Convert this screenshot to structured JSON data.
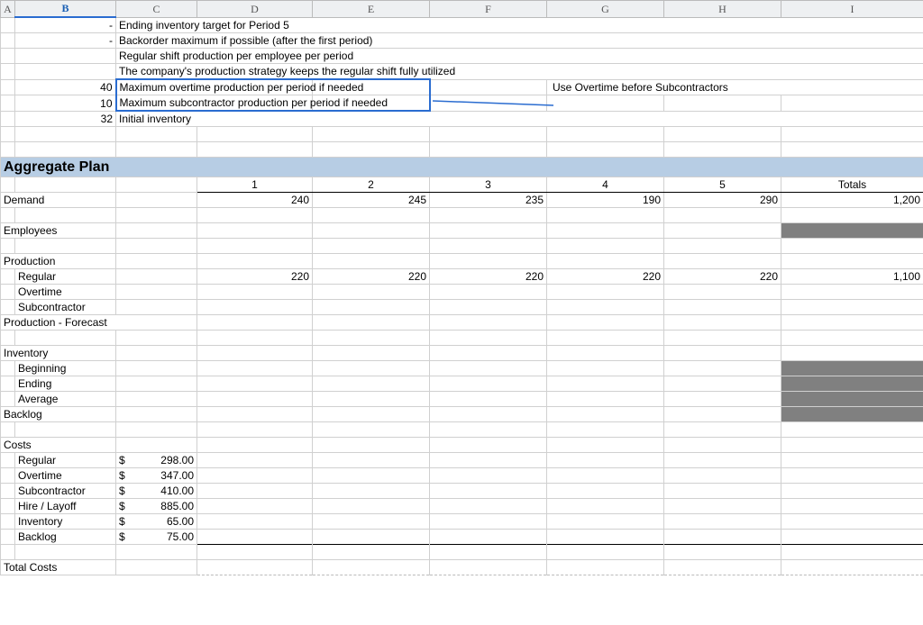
{
  "columns": [
    "A",
    "B",
    "C",
    "D",
    "E",
    "F",
    "G",
    "H",
    "I"
  ],
  "selectedColumn": "B",
  "assumptions": {
    "r1": {
      "b": "-",
      "c": "Ending inventory target for Period 5"
    },
    "r2": {
      "b": "-",
      "c": "Backorder maximum if possible (after the first period)"
    },
    "r3": {
      "c": "Regular shift production per employee per period"
    },
    "r4": {
      "c": "The company's production strategy keeps the regular shift fully utilized"
    },
    "r5": {
      "b": "40",
      "c": "Maximum overtime production per period if needed"
    },
    "r6": {
      "b": "10",
      "c": "Maximum subcontractor production per period if needed"
    },
    "r7": {
      "b": "32",
      "c": "Initial inventory"
    }
  },
  "callout": "Use Overtime before Subcontractors",
  "section_title": "Aggregate Plan",
  "periods": {
    "d": "1",
    "e": "2",
    "f": "3",
    "g": "4",
    "h": "5",
    "i": "Totals"
  },
  "demand": {
    "label": "Demand",
    "d": "240",
    "e": "245",
    "f": "235",
    "g": "190",
    "h": "290",
    "i": "1,200"
  },
  "employees": {
    "label": "Employees"
  },
  "production": {
    "label": "Production",
    "regular": {
      "label": "Regular",
      "d": "220",
      "e": "220",
      "f": "220",
      "g": "220",
      "h": "220",
      "i": "1,100"
    },
    "overtime": {
      "label": "Overtime"
    },
    "sub": {
      "label": "Subcontractor"
    },
    "pfc": "Production - Forecast"
  },
  "inventory": {
    "label": "Inventory",
    "beginning": "Beginning",
    "ending": "Ending",
    "average": "Average"
  },
  "backlog": {
    "label": "Backlog"
  },
  "costs": {
    "label": "Costs",
    "regular": {
      "label": "Regular",
      "sym": "$",
      "val": "298.00"
    },
    "overtime": {
      "label": "Overtime",
      "sym": "$",
      "val": "347.00"
    },
    "sub": {
      "label": "Subcontractor",
      "sym": "$",
      "val": "410.00"
    },
    "hire": {
      "label": "Hire / Layoff",
      "sym": "$",
      "val": "885.00"
    },
    "inv": {
      "label": "Inventory",
      "sym": "$",
      "val": "65.00"
    },
    "backlog": {
      "label": "Backlog",
      "sym": "$",
      "val": "75.00"
    }
  },
  "total": {
    "label": "Total Costs"
  }
}
